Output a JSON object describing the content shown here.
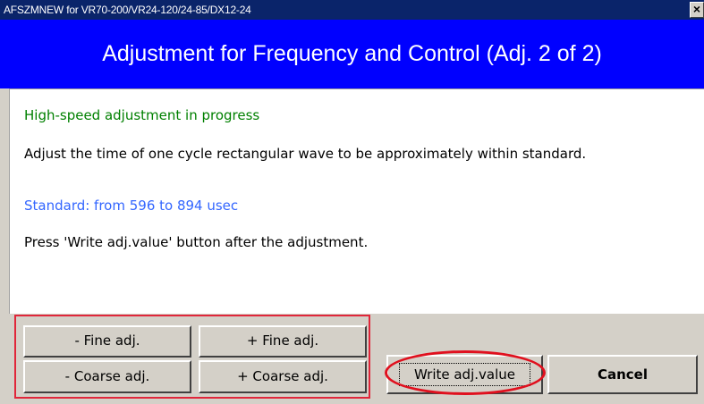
{
  "window": {
    "title": "AFSZMNEW for VR70-200/VR24-120/24-85/DX12-24",
    "close_glyph": "×"
  },
  "header": {
    "heading": "Adjustment for Frequency and Control (Adj. 2 of 2)",
    "color": "#0000ff"
  },
  "content": {
    "status": "High-speed adjustment in progress",
    "instruction": "Adjust the time of one cycle rectangular wave to be approximately within standard.",
    "standard": "Standard: from 596 to 894 usec",
    "press_note": "Press 'Write adj.value' button after the adjustment."
  },
  "buttons": {
    "fine_minus": "- Fine adj.",
    "fine_plus": "+ Fine adj.",
    "coarse_minus": "- Coarse adj.",
    "coarse_plus": "+ Coarse adj.",
    "write": "Write adj.value",
    "cancel": "Cancel"
  },
  "colors": {
    "status": "#008000",
    "standard": "#3366ff",
    "highlight": "#e0101e"
  }
}
